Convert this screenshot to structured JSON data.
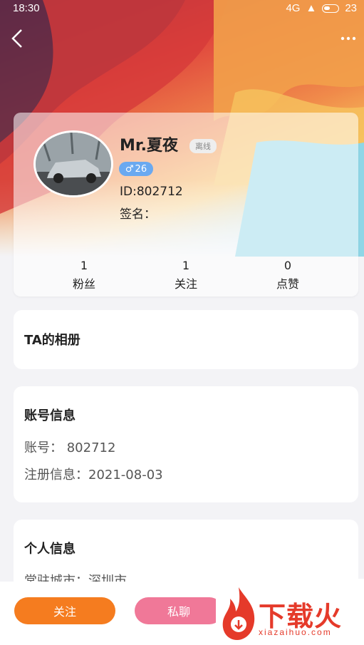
{
  "status_bar": {
    "time": "18:30",
    "signal": "4G",
    "battery": "23"
  },
  "profile": {
    "name": "Mr.夏夜",
    "online_status": "离线",
    "gender_symbol": "♂",
    "age": "26",
    "id_text": "ID:802712",
    "signature_text": "签名："
  },
  "stats": [
    {
      "value": "1",
      "label": "粉丝"
    },
    {
      "value": "1",
      "label": "关注"
    },
    {
      "value": "0",
      "label": "点赞"
    }
  ],
  "album": {
    "title": "TA的相册"
  },
  "account": {
    "title": "账号信息",
    "account_line": "账号：  802712",
    "register_line": "注册信息：2021-08-03"
  },
  "personal": {
    "title": "个人信息",
    "city_line": "常驻城市：深圳市"
  },
  "actions": {
    "follow_label": "关注",
    "chat_label": "私聊"
  },
  "watermark": {
    "text": "下载火",
    "sub": "xiazaihuo.com"
  },
  "colors": {
    "follow": "#f57c1f",
    "chat": "#f07898",
    "gender_badge": "#6aa9f0"
  }
}
